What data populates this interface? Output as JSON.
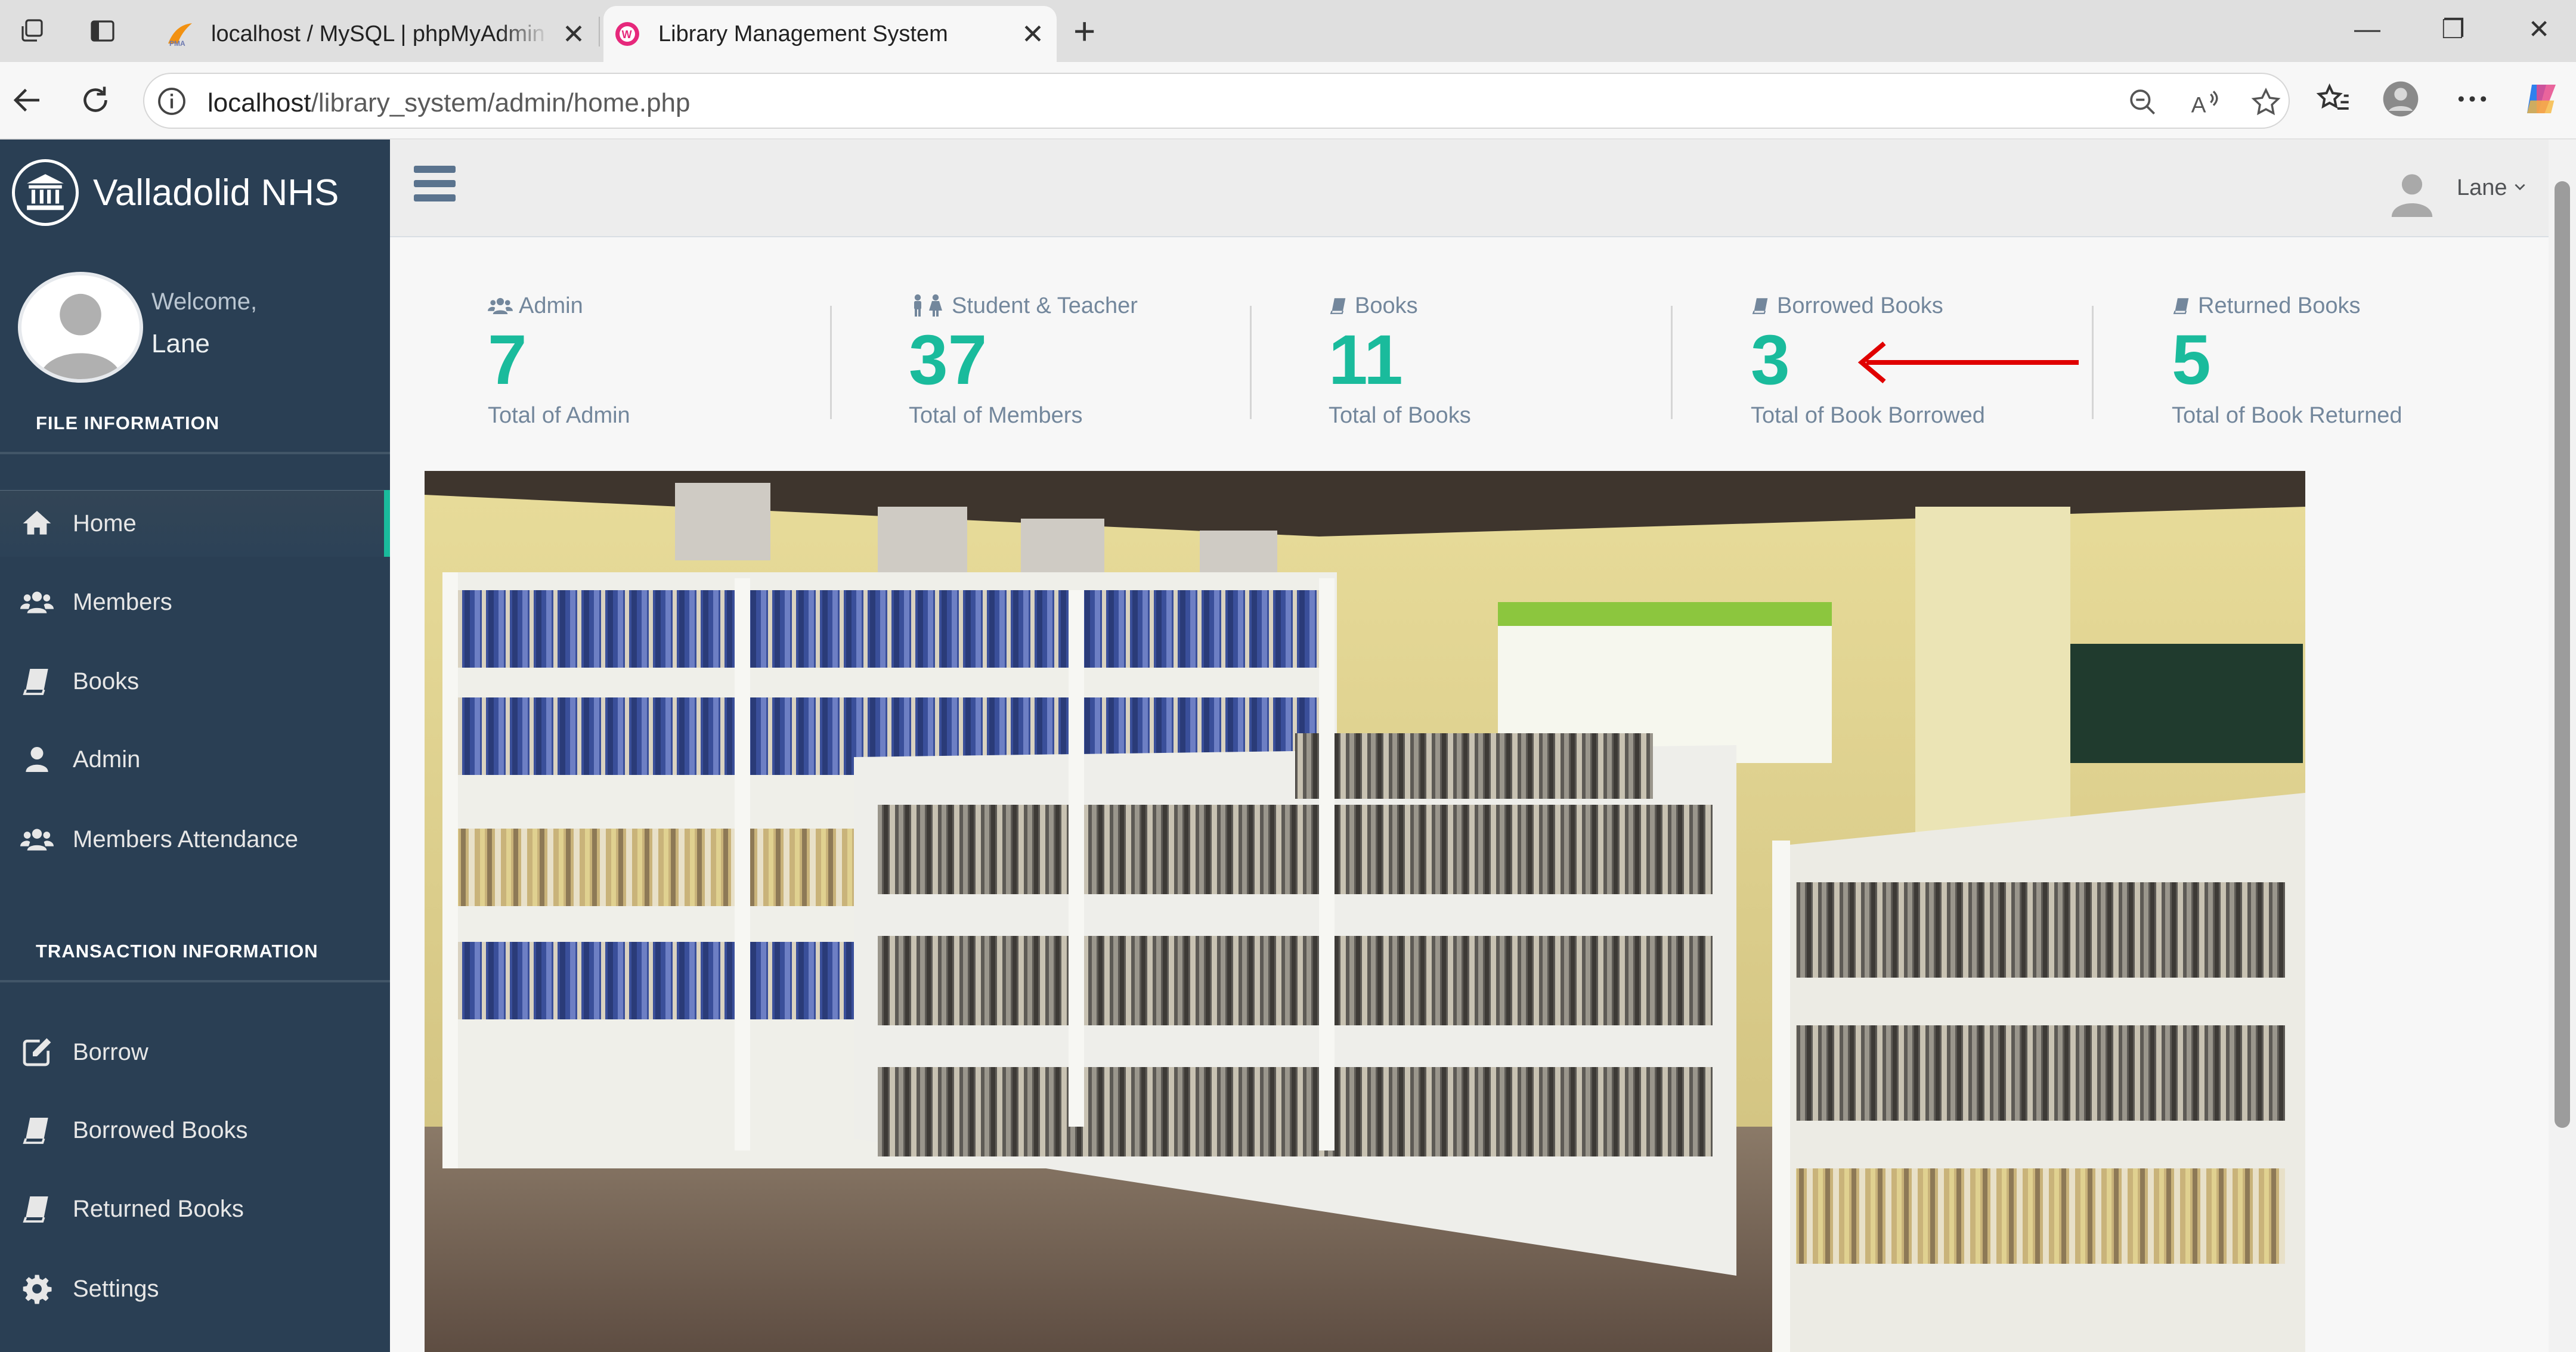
{
  "browser": {
    "tabs": [
      {
        "title": "localhost / MySQL | phpMyAdmin",
        "close": "✕"
      },
      {
        "title": "Library Management System",
        "close": "✕"
      }
    ],
    "new_tab": "+",
    "address": {
      "host": "localhost",
      "path": "/library_system/admin/home.php"
    },
    "window_controls": {
      "minimize": "—",
      "restore": "❐",
      "close": "✕"
    }
  },
  "sidebar": {
    "brand": "Valladolid NHS",
    "welcome": "Welcome,",
    "user": "Lane",
    "sections": [
      {
        "title": "FILE INFORMATION",
        "items": [
          {
            "label": "Home",
            "icon": "home-icon"
          },
          {
            "label": "Members",
            "icon": "users-icon"
          },
          {
            "label": "Books",
            "icon": "book-icon"
          },
          {
            "label": "Admin",
            "icon": "user-icon"
          },
          {
            "label": "Members Attendance",
            "icon": "users-icon"
          }
        ]
      },
      {
        "title": "TRANSACTION INFORMATION",
        "items": [
          {
            "label": "Borrow",
            "icon": "edit-icon"
          },
          {
            "label": "Borrowed Books",
            "icon": "book-icon"
          },
          {
            "label": "Returned Books",
            "icon": "book-icon"
          },
          {
            "label": "Settings",
            "icon": "gear-icon"
          }
        ]
      }
    ]
  },
  "topnav": {
    "user": "Lane"
  },
  "stats": [
    {
      "label": "Admin",
      "count": "7",
      "sub": "Total of Admin",
      "icon": "users-icon"
    },
    {
      "label": "Student & Teacher",
      "count": "37",
      "sub": "Total of Members",
      "icon": "male-female-icon"
    },
    {
      "label": "Books",
      "count": "11",
      "sub": "Total of Books",
      "icon": "book-icon"
    },
    {
      "label": "Borrowed Books",
      "count": "3",
      "sub": "Total of Book Borrowed",
      "icon": "book-icon"
    },
    {
      "label": "Returned Books",
      "count": "5",
      "sub": "Total of Book Returned",
      "icon": "book-icon"
    }
  ],
  "colors": {
    "sidebar": "#2a3f54",
    "accent": "#1abb9c",
    "muted": "#73879c",
    "arrow": "#e00000"
  }
}
